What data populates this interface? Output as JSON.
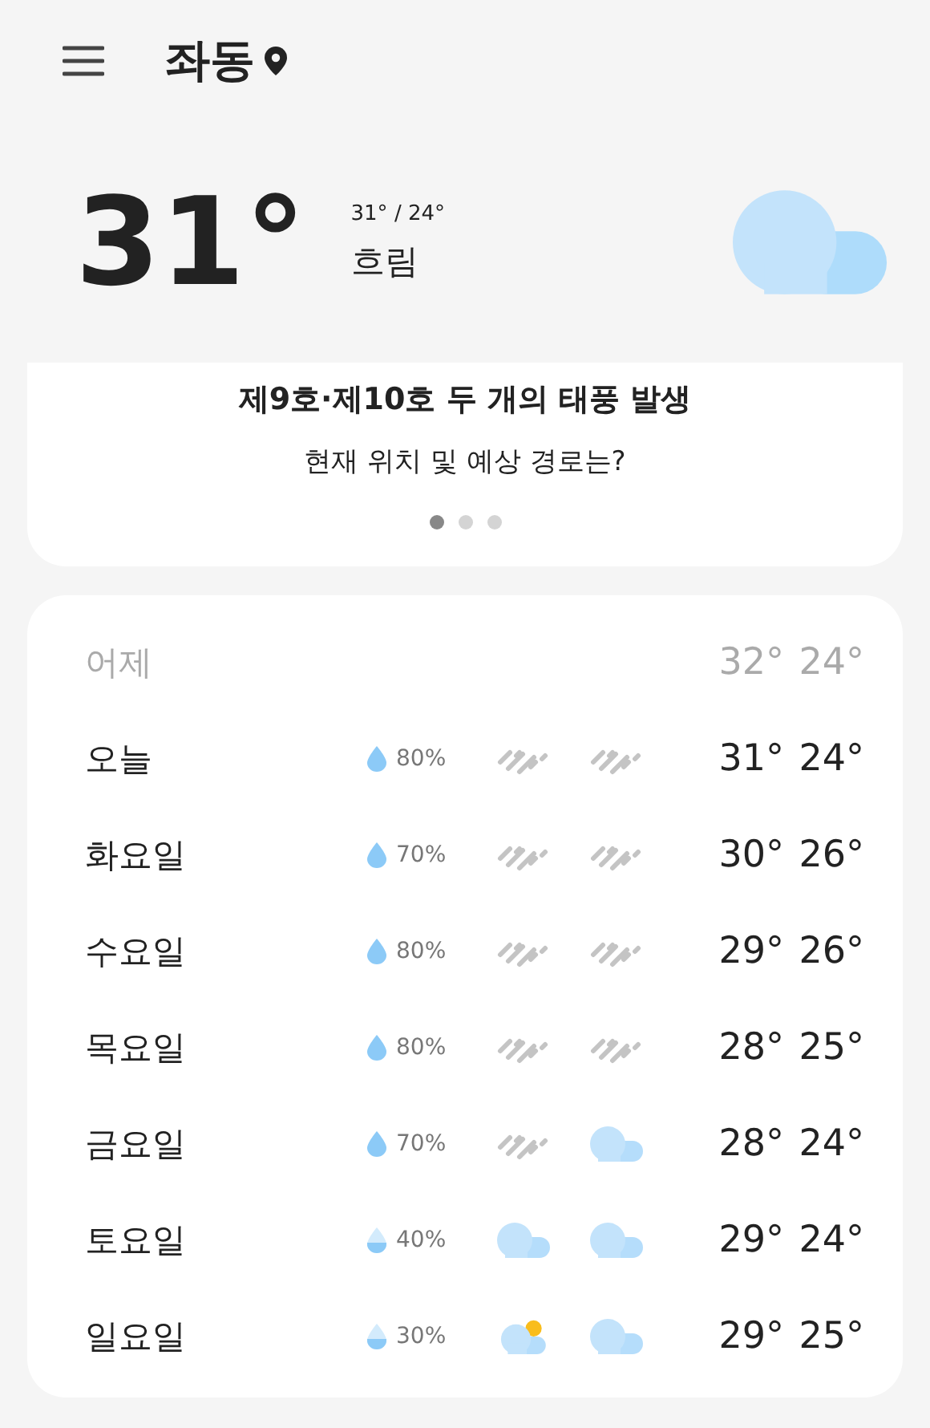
{
  "header": {
    "location": "좌동"
  },
  "current": {
    "temp": "31°",
    "high_low": "31° / 24°",
    "condition": "흐림"
  },
  "banner": {
    "title": "제9호·제10호 두 개의 태풍 발생",
    "subtitle": "현재 위치 및 예상 경로는?",
    "pages": [
      {
        "selected": true
      },
      {
        "selected": false
      },
      {
        "selected": false
      }
    ]
  },
  "forecast": [
    {
      "day": "어제",
      "kind": "past",
      "high": "32°",
      "low": "24°"
    },
    {
      "day": "오늘",
      "kind": "day",
      "drop": {
        "kind": "full"
      },
      "rain": "80%",
      "icons": [
        {
          "kind": "rain"
        },
        {
          "kind": "rain"
        }
      ],
      "high": "31°",
      "low": "24°"
    },
    {
      "day": "화요일",
      "kind": "day",
      "drop": {
        "kind": "full"
      },
      "rain": "70%",
      "icons": [
        {
          "kind": "rain"
        },
        {
          "kind": "rain"
        }
      ],
      "high": "30°",
      "low": "26°"
    },
    {
      "day": "수요일",
      "kind": "day",
      "drop": {
        "kind": "full"
      },
      "rain": "80%",
      "icons": [
        {
          "kind": "rain"
        },
        {
          "kind": "rain"
        }
      ],
      "high": "29°",
      "low": "26°"
    },
    {
      "day": "목요일",
      "kind": "day",
      "drop": {
        "kind": "full"
      },
      "rain": "80%",
      "icons": [
        {
          "kind": "rain"
        },
        {
          "kind": "rain"
        }
      ],
      "high": "28°",
      "low": "25°"
    },
    {
      "day": "금요일",
      "kind": "day",
      "drop": {
        "kind": "full"
      },
      "rain": "70%",
      "icons": [
        {
          "kind": "rain"
        },
        {
          "kind": "cloud"
        }
      ],
      "high": "28°",
      "low": "24°"
    },
    {
      "day": "토요일",
      "kind": "day",
      "drop": {
        "kind": "partial"
      },
      "rain": "40%",
      "icons": [
        {
          "kind": "cloud"
        },
        {
          "kind": "cloud"
        }
      ],
      "high": "29°",
      "low": "24°"
    },
    {
      "day": "일요일",
      "kind": "day",
      "drop": {
        "kind": "partial"
      },
      "rain": "30%",
      "icons": [
        {
          "kind": "sun"
        },
        {
          "kind": "cloud"
        }
      ],
      "high": "29°",
      "low": "25°"
    }
  ]
}
